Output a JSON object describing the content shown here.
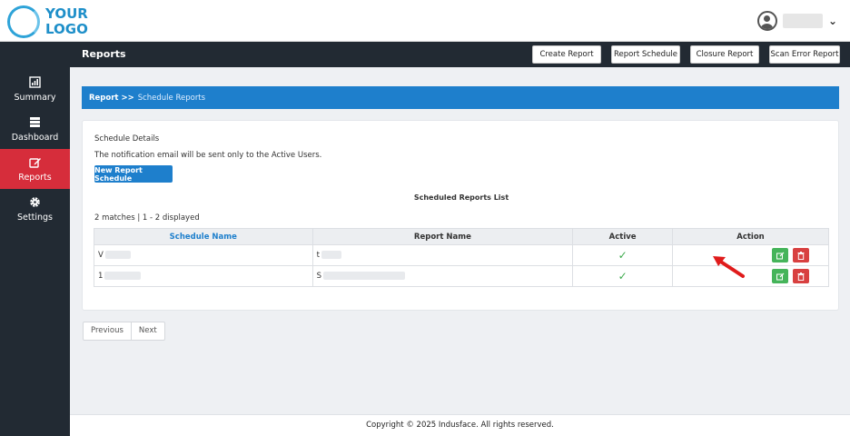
{
  "logo": {
    "line1": "YOUR",
    "line2": "LOGO"
  },
  "user": {
    "chevron": "⌄"
  },
  "sidebar": {
    "items": [
      {
        "label": "Summary",
        "icon": "chart-icon"
      },
      {
        "label": "Dashboard",
        "icon": "server-icon"
      },
      {
        "label": "Reports",
        "icon": "edit-icon",
        "active": true
      },
      {
        "label": "Settings",
        "icon": "gear-icon"
      }
    ]
  },
  "header": {
    "title": "Reports",
    "buttons": [
      "Create Report",
      "Report Schedule",
      "Closure Report",
      "Scan Error Report"
    ]
  },
  "breadcrumb": {
    "parent": "Report >>",
    "current": "Schedule Reports"
  },
  "schedule": {
    "title": "Schedule Details",
    "note": "The notification email will be sent only to the Active Users.",
    "new_button": "New Report Schedule",
    "list_title": "Scheduled Reports List",
    "matches": "2 matches | 1 - 2 displayed",
    "columns": [
      "Schedule Name",
      "Report Name",
      "Active",
      "Action"
    ],
    "rows": [
      {
        "name": "V",
        "report": "t",
        "active": "✓"
      },
      {
        "name": "1",
        "report": "S",
        "active": "✓"
      }
    ]
  },
  "pager": {
    "prev": "Previous",
    "next": "Next"
  },
  "footer": {
    "text": "Copyright © 2025 Indusface. All rights reserved."
  },
  "colors": {
    "accent": "#1e7fcc",
    "sidebar": "#222a33",
    "active_nav": "#d62d3b",
    "edit": "#45b45a",
    "delete": "#d84040"
  }
}
